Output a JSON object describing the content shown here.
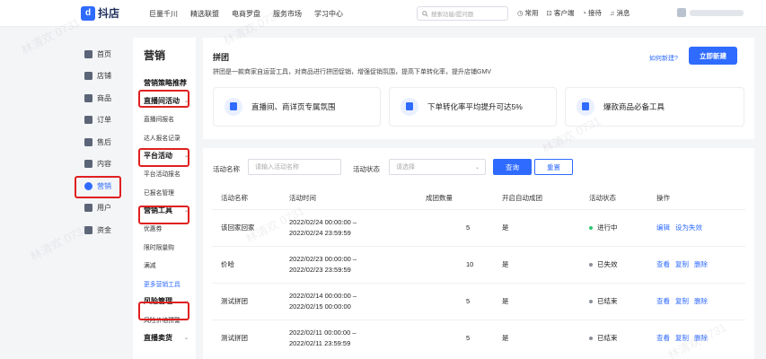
{
  "brand": {
    "logo_glyph": "d",
    "name": "抖店"
  },
  "topnav": [
    "巨量千川",
    "精选联盟",
    "电商罗盘",
    "服务市场",
    "学习中心"
  ],
  "search": {
    "placeholder": "搜索功能/提问题"
  },
  "topright": [
    {
      "icon": "clock-icon",
      "label": "常用"
    },
    {
      "icon": "download-icon",
      "label": "客户端"
    },
    {
      "icon": "headset-icon",
      "label": "接待"
    },
    {
      "icon": "bell-icon",
      "label": "消息"
    }
  ],
  "leftnav": [
    {
      "icon": "home-icon",
      "label": "首页"
    },
    {
      "icon": "store-icon",
      "label": "店铺"
    },
    {
      "icon": "product-icon",
      "label": "商品"
    },
    {
      "icon": "order-icon",
      "label": "订单"
    },
    {
      "icon": "aftersale-icon",
      "label": "售后"
    },
    {
      "icon": "content-icon",
      "label": "内容"
    },
    {
      "icon": "marketing-icon",
      "label": "营销",
      "active": true
    },
    {
      "icon": "user-icon",
      "label": "用户"
    },
    {
      "icon": "funds-icon",
      "label": "资金"
    }
  ],
  "submenu": {
    "title": "营销",
    "entries": [
      {
        "type": "group",
        "label": "营销策略推荐"
      },
      {
        "type": "group",
        "label": "直播间活动",
        "chevron": "⌄"
      },
      {
        "type": "sub",
        "label": "直播间报名"
      },
      {
        "type": "sub",
        "label": "达人报名记录"
      },
      {
        "type": "group",
        "label": "平台活动",
        "chevron": "⌄"
      },
      {
        "type": "sub",
        "label": "平台活动报名"
      },
      {
        "type": "sub",
        "label": "已报名管理"
      },
      {
        "type": "group",
        "label": "营销工具",
        "chevron": "⌄"
      },
      {
        "type": "sub",
        "label": "优惠券"
      },
      {
        "type": "sub",
        "label": "限时限量购"
      },
      {
        "type": "sub",
        "label": "满减"
      },
      {
        "type": "more",
        "label": "更多营销工具"
      },
      {
        "type": "group",
        "label": "风险管理",
        "chevron": "⌄"
      },
      {
        "type": "sub",
        "label": "风险价格预警"
      },
      {
        "type": "group",
        "label": "直播卖货",
        "chevron": "⌄"
      }
    ]
  },
  "header": {
    "title": "拼团",
    "description": "拼团是一款商家自运营工具，对商品进行拼团促销，增强促销氛围，提高下单转化率，提升店铺GMV",
    "how_link": "如何新建?",
    "new_button": "立即新建"
  },
  "features": [
    {
      "icon": "cart-icon",
      "label": "直播间、商详页专属氛围"
    },
    {
      "icon": "document-icon",
      "label": "下单转化率平均提升可达5%"
    },
    {
      "icon": "bag-icon",
      "label": "爆款商品必备工具"
    }
  ],
  "filters": {
    "name_label": "活动名称",
    "name_placeholder": "请输入活动名称",
    "status_label": "活动状态",
    "status_placeholder": "请选择",
    "query_button": "查询",
    "reset_button": "重置"
  },
  "table": {
    "columns": [
      "活动名称",
      "活动时间",
      "成团数量",
      "开启自动成团",
      "活动状态",
      "操作"
    ],
    "rows": [
      {
        "name": "该回家回家",
        "start": "2022/02/24 00:00:00 –",
        "end": "2022/02/24 23:59:59",
        "count": "5",
        "auto": "是",
        "status": "进行中",
        "status_color": "#2ec771",
        "ops": [
          "编辑",
          "设为失效"
        ]
      },
      {
        "name": "价哈",
        "start": "2022/02/23 00:00:00 –",
        "end": "2022/02/23 23:59:59",
        "count": "10",
        "auto": "是",
        "status": "已失效",
        "status_color": "#8a8f99",
        "ops": [
          "查看",
          "复制",
          "删除"
        ]
      },
      {
        "name": "测试拼团",
        "start": "2022/02/14 00:00:00 –",
        "end": "2022/02/15 00:00:00",
        "count": "5",
        "auto": "是",
        "status": "已结束",
        "status_color": "#8a8f99",
        "ops": [
          "查看",
          "复制",
          "删除"
        ]
      },
      {
        "name": "测试拼团",
        "start": "2022/02/11 00:00:00 –",
        "end": "2022/02/11 23:59:59",
        "count": "5",
        "auto": "是",
        "status": "已结束",
        "status_color": "#8a8f99",
        "ops": [
          "查看",
          "复制",
          "删除"
        ]
      }
    ]
  },
  "watermark_text": "林清欢 0731",
  "colors": {
    "accent": "#2f6bff",
    "highlight_box": "#e02020"
  }
}
